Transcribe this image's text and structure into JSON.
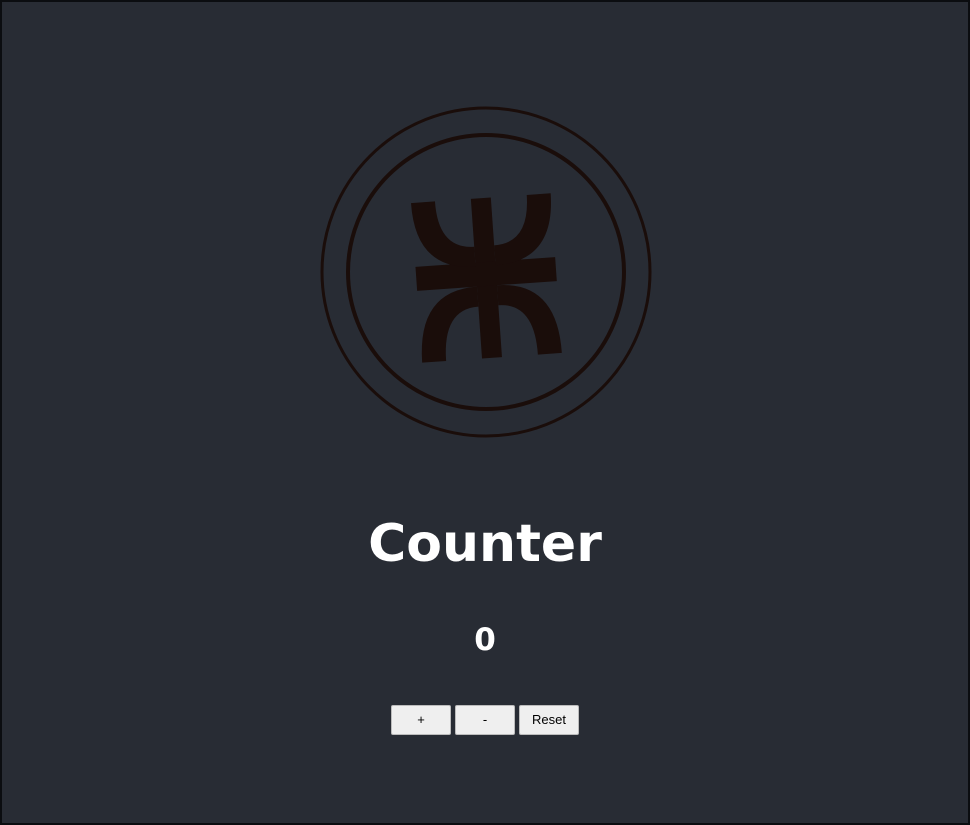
{
  "logo": {
    "icon": "utn-logo-icon",
    "color": "#1a0d0a"
  },
  "counter": {
    "title": "Counter",
    "value": "0"
  },
  "buttons": {
    "increment_label": "+",
    "decrement_label": "-",
    "reset_label": "Reset"
  },
  "colors": {
    "background": "#282c34",
    "text": "#ffffff",
    "button_bg": "#efefef"
  }
}
